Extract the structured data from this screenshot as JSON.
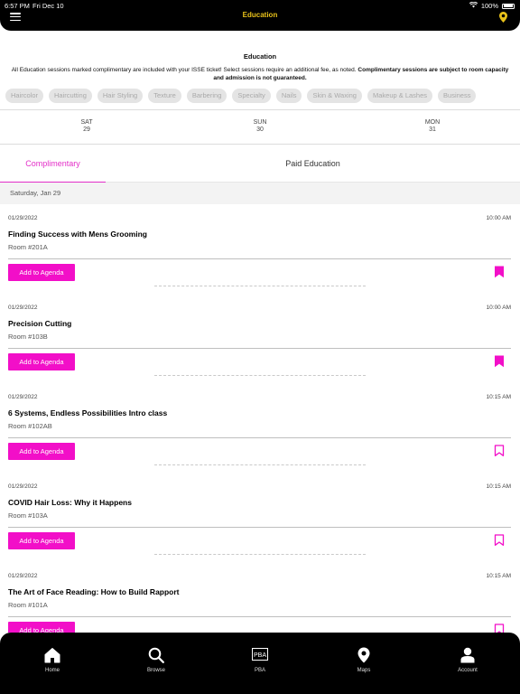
{
  "status_bar": {
    "time": "6:57 PM",
    "date": "Fri Dec 10",
    "battery": "100%"
  },
  "header": {
    "title": "Education"
  },
  "intro": {
    "heading": "Education",
    "text_normal": "All Education sessions marked complimentary are included with your ISSE ticket! Select sessions require an additional fee, as noted. ",
    "text_bold": "Complimentary sessions are subject to room capacity and admission is not guaranteed."
  },
  "categories": [
    "Haircolor",
    "Haircutting",
    "Hair Styling",
    "Texture",
    "Barbering",
    "Specialty",
    "Nails",
    "Skin & Waxing",
    "Makeup & Lashes",
    "Business"
  ],
  "days": [
    {
      "weekday": "SAT",
      "date": "29"
    },
    {
      "weekday": "SUN",
      "date": "30"
    },
    {
      "weekday": "MON",
      "date": "31"
    }
  ],
  "tabs": {
    "complimentary": "Complimentary",
    "paid": "Paid Education"
  },
  "date_header": "Saturday, Jan 29",
  "sessions": [
    {
      "date": "01/29/2022",
      "time": "10:00 AM",
      "title": "Finding Success with Mens Grooming",
      "room": "Room #201A",
      "button": "Add to Agenda",
      "bookmarked": true
    },
    {
      "date": "01/29/2022",
      "time": "10:00 AM",
      "title": "Precision Cutting",
      "room": "Room #103B",
      "button": "Add to Agenda",
      "bookmarked": true
    },
    {
      "date": "01/29/2022",
      "time": "10:15 AM",
      "title": "6 Systems, Endless Possibilities Intro class",
      "room": "Room #102AB",
      "button": "Add to Agenda",
      "bookmarked": false
    },
    {
      "date": "01/29/2022",
      "time": "10:15 AM",
      "title": "COVID Hair Loss: Why it Happens",
      "room": "Room #103A",
      "button": "Add to Agenda",
      "bookmarked": false
    },
    {
      "date": "01/29/2022",
      "time": "10:15 AM",
      "title": "The Art of Face Reading: How to Build Rapport",
      "room": "Room #101A",
      "button": "Add to Agenda",
      "bookmarked": false
    }
  ],
  "tabbar": {
    "home": "Home",
    "browse": "Browse",
    "pba": "PBA",
    "pba_icon_text": "PBA",
    "maps": "Maps",
    "account": "Account"
  },
  "colors": {
    "accent": "#f20fc8",
    "header_title": "#e9c21a",
    "tab_active": "#e32ec8",
    "chip_bg": "#e4e4e4"
  },
  "icons": [
    "hamburger-icon",
    "location-pin-icon",
    "wifi-icon",
    "battery-icon",
    "bookmark-icon",
    "home-icon",
    "search-icon",
    "pba-logo-icon",
    "map-pin-icon",
    "account-icon"
  ]
}
